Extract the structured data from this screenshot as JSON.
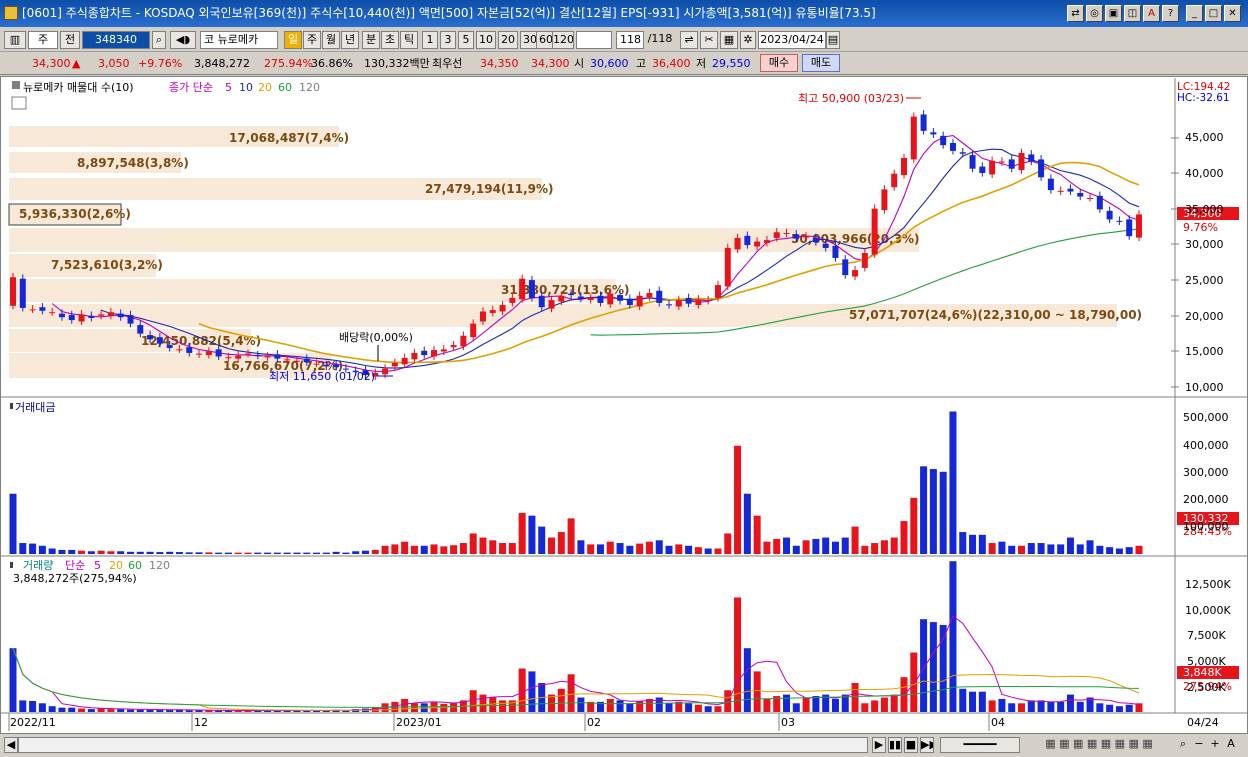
{
  "window": {
    "title": "[0601] 주식종합차트 - KOSDAQ 외국인보유[369(천)] 주식수[10,440(천)] 액면[500] 자본금[52(억)] 결산[12월] EPS[-931] 시가총액[3,581(억)] 유통비율[73.5]"
  },
  "toolbar": {
    "market": "주",
    "prev_label": "전",
    "code": "348340",
    "name": "뉴로메카",
    "period_tabs": [
      "일",
      "주",
      "월",
      "년",
      "분",
      "초",
      "틱"
    ],
    "num_tabs": [
      "1",
      "3",
      "5",
      "10",
      "20",
      "30",
      "60",
      "120"
    ],
    "count": "118",
    "count_total": "/118",
    "date": "2023/04/24"
  },
  "quote": {
    "price": "34,300",
    "arrow": "▲",
    "change": "3,050",
    "rate": "+9.76%",
    "volume": "3,848,272",
    "vol_rate": "275.94%",
    "turnover": "36.86%",
    "amount": "130,332백만",
    "best_label": "최우선",
    "ask": "34,350",
    "bid": "34,300",
    "open_label": "시",
    "open": "30,600",
    "high_label": "고",
    "high": "36,400",
    "low_label": "저",
    "low": "29,550",
    "buy": "매수",
    "sell": "매도"
  },
  "price_panel": {
    "legend_name": "뉴로메카 매물대 수(10)",
    "legend_ma": "종가 단순",
    "ma_periods": [
      "5",
      "10",
      "20",
      "60",
      "120"
    ],
    "high_label": "최고 50,900 (03/23)",
    "low_label": "최저 11,650 (01/02)",
    "dividend_label": "배당락(0,00%)",
    "lc": "LC:194.42",
    "hc": "HC:-32.61",
    "current_price": "34,300",
    "current_rate": "9.76%",
    "yticks": [
      "45,000",
      "40,000",
      "35,000",
      "30,000",
      "25,000",
      "20,000",
      "15,000",
      "10,000"
    ],
    "profile": [
      {
        "label": "17,068,487(7,4%)"
      },
      {
        "label": "8,897,548(3,8%)"
      },
      {
        "label": "27,479,194(11,9%)"
      },
      {
        "label": "5,936,330(2,6%)"
      },
      {
        "label": "50,003,966(20,3%)"
      },
      {
        "label": "7,523,610(3,2%)"
      },
      {
        "label": "31,380,721(13,6%)"
      },
      {
        "label": "57,071,707(24,6%)(22,310,00 ~ 18,790,00)"
      },
      {
        "label": "12,450,882(5,4%)"
      },
      {
        "label": "16,766,670(7,2%)"
      }
    ]
  },
  "amount_panel": {
    "title": "거래대금",
    "current": "130,332",
    "rate": "284.45%",
    "yticks": [
      "500,000",
      "400,000",
      "300,000",
      "200,000",
      "100,000"
    ]
  },
  "volume_panel": {
    "title": "거래량",
    "legend_ma": "단순",
    "ma_periods": [
      "5",
      "20",
      "60",
      "120"
    ],
    "current_text": "3,848,272주(275,94%)",
    "current": "3,848K",
    "rate": "275.94%",
    "yticks": [
      "12,500K",
      "10,000K",
      "7,500K",
      "5,000K",
      "2,500K"
    ]
  },
  "xaxis": {
    "labels": [
      "2022/11",
      "12",
      "2023/01",
      "02",
      "03",
      "04"
    ],
    "right_label": "04/24"
  },
  "colors": {
    "up": "#e8141c",
    "down": "#1428d8",
    "ma5": "#c000c0",
    "ma10": "#1a2bb0",
    "ma20": "#e0a000",
    "ma60": "#20a040",
    "profile": "#f8e8d8"
  }
}
